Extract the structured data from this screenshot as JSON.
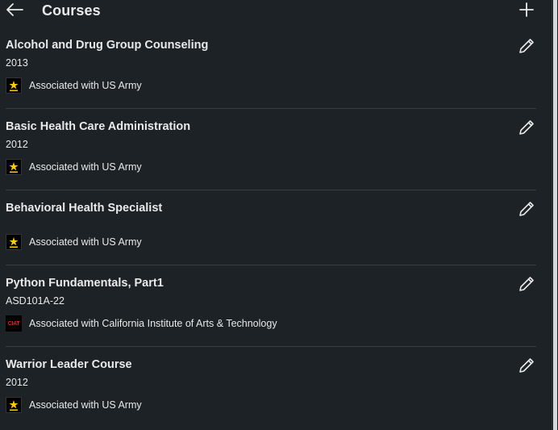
{
  "header": {
    "title": "Courses",
    "back_icon": "arrow-left-icon",
    "add_icon": "plus-icon"
  },
  "courses": [
    {
      "name": "Alcohol and Drug Group Counseling",
      "meta": "2013",
      "association": "Associated with US Army",
      "logo": "us-army-logo"
    },
    {
      "name": "Basic Health Care Administration",
      "meta": "2012",
      "association": "Associated with US Army",
      "logo": "us-army-logo"
    },
    {
      "name": "Behavioral Health Specialist",
      "meta": "",
      "association": "Associated with US Army",
      "logo": "us-army-logo"
    },
    {
      "name": "Python Fundamentals, Part1",
      "meta": "ASD101A-22",
      "association": "Associated with California Institute of Arts & Technology",
      "logo": "ciat-logo",
      "logo_text": "CIAT"
    },
    {
      "name": "Warrior Leader Course",
      "meta": "2012",
      "association": "Associated with US Army",
      "logo": "us-army-logo"
    }
  ],
  "colors": {
    "background": "#1d2226",
    "text": "#e7e9ea",
    "divider": "#383d42",
    "ciat_red": "#e21e2a",
    "army_gold": "#ffcc01"
  }
}
